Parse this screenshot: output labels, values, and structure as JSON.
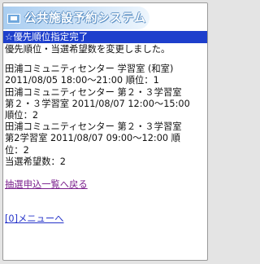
{
  "header": {
    "app_title": "公共施設予約システム"
  },
  "title_bar": {
    "icon": "☆",
    "label": "優先順位指定完了"
  },
  "message": "優先順位・当選希望数を変更しました。",
  "reservations": [
    {
      "lines": [
        "田浦コミュニティセンター 学習室 (和室)",
        "2011/08/05 18:00～21:00 順位：1"
      ]
    },
    {
      "lines": [
        "田浦コミュニティセンター 第２・３学習室",
        "第２・３学習室 2011/08/07 12:00～15:00",
        "順位：2"
      ]
    },
    {
      "lines": [
        "田浦コミュニティセンター 第２・３学習室",
        "第2学習室 2011/08/07 09:00～12:00 順",
        "位：2"
      ]
    }
  ],
  "desired_wins": "当選希望数：2",
  "links": {
    "back_to_list": "抽選申込一覧へ戻る",
    "menu": "[0]メニューへ"
  }
}
